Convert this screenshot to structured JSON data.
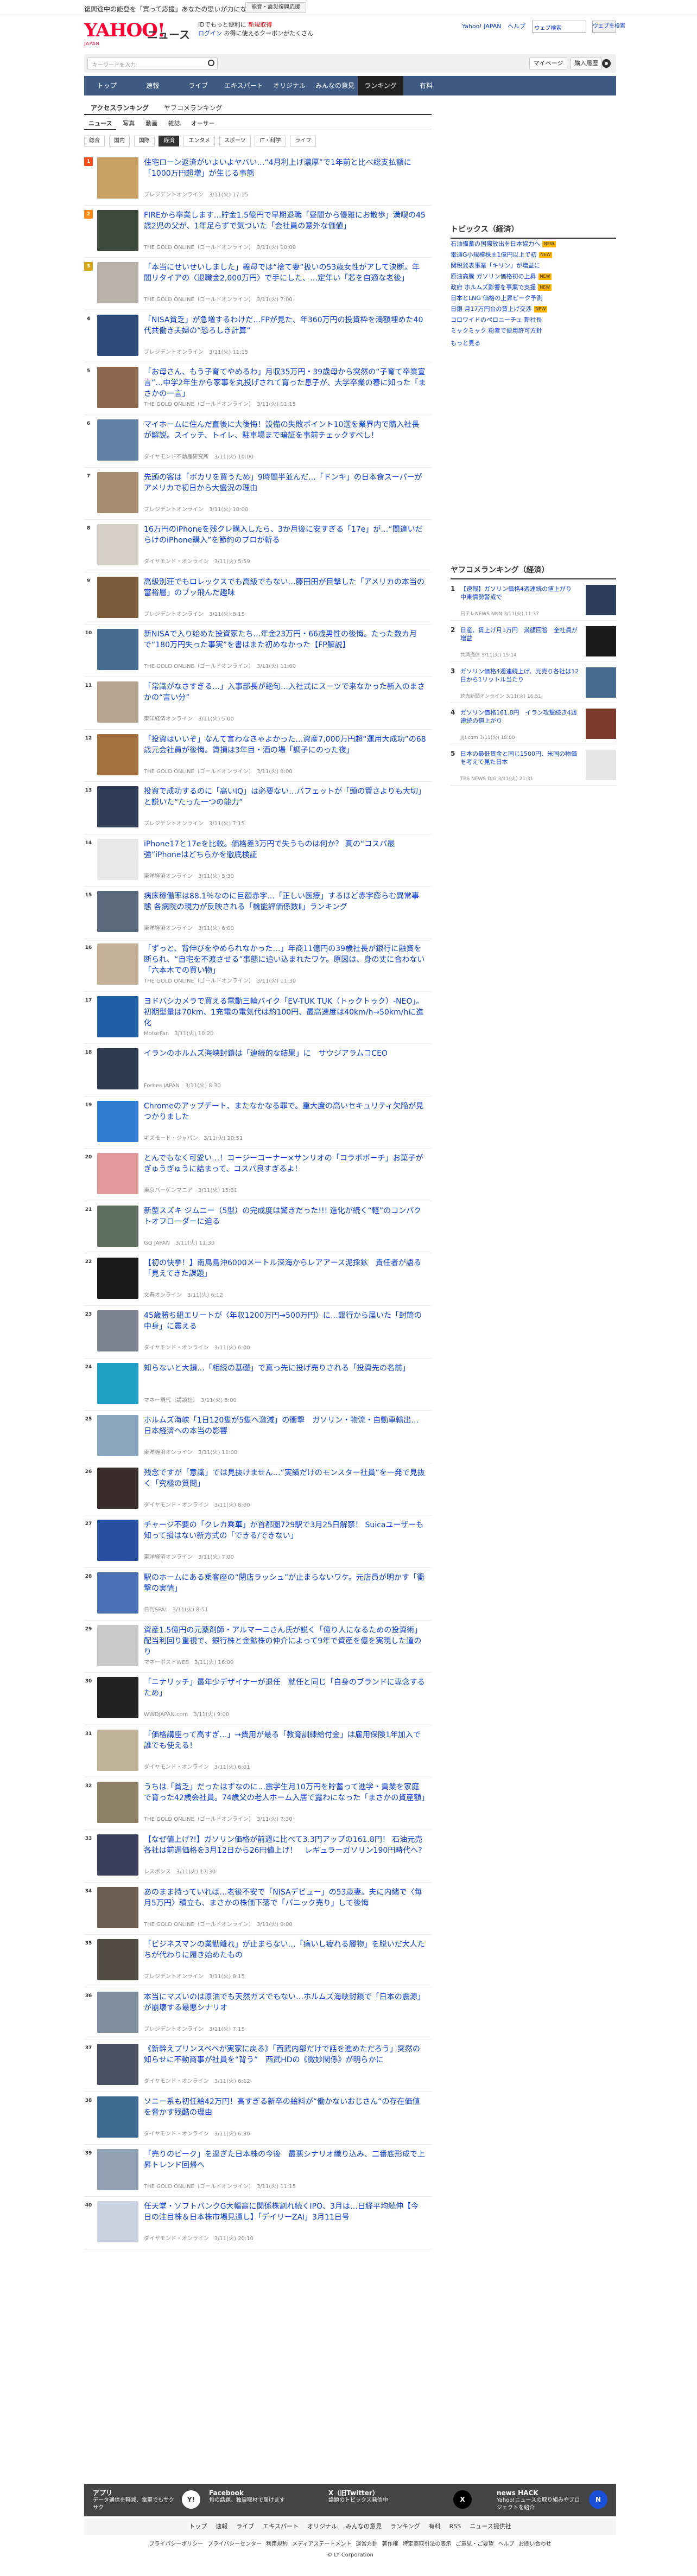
{
  "notice": {
    "text": "復興途中の能登を「買って応援」あなたの思いが力になります。",
    "badge": "能登・震災復興応援"
  },
  "header": {
    "logo": "YAHOO!",
    "logo_sub": "JAPAN",
    "service": "ニュース",
    "links_row1_prefix": "IDでもっと便利に",
    "links_row1_link": "新規取得",
    "links_row2_prefix": "ログイン",
    "links_row2_text": "お得に使えるクーポンがたくさん",
    "right_links": [
      "Yahoo! JAPAN",
      "ヘルプ"
    ],
    "search_placeholder": "ウェブ検索",
    "search_button": "ウェブを検索"
  },
  "searchbar": {
    "placeholder": "キーワードを入力",
    "mypage": "マイページ",
    "purchase": "購入履歴"
  },
  "nav": [
    "トップ",
    "速報",
    "ライブ",
    "エキスパート",
    "オリジナル",
    "みんなの意見",
    "ランキング",
    "有料"
  ],
  "subtabs": [
    "アクセスランキング",
    "ヤフコメランキング"
  ],
  "section_tabs": [
    "ニュース",
    "写真",
    "動画",
    "雑誌",
    "オーサー"
  ],
  "category_tabs": [
    "総合",
    "国内",
    "国際",
    "経済",
    "エンタメ",
    "スポーツ",
    "IT・科学",
    "ライフ"
  ],
  "ranking": [
    {
      "rank": "1",
      "title": "住宅ローン返済がいよいよヤバい…“4月利上げ濃厚”で1年前と比べ総支払額に「1000万円超増」が生じる事態",
      "meta": "プレジデントオンライン　3/11(火) 17:15"
    },
    {
      "rank": "2",
      "title": "FIREから卒業します…貯金1.5億円で早期退職「昼間から優雅にお散歩」満喫の45歳2児の父が、1年足らずで気づいた「会社員の意外な価値」",
      "meta": "THE GOLD ONLINE（ゴールドオンライン）　3/11(火) 10:00"
    },
    {
      "rank": "3",
      "title": "「本当にせいせいしました」義母では“捨て妻”扱いの53歳女性がアして決断。年間リタイアの〈退職金2,000万円〉で手にした、…定年い「芯を自適な老後」",
      "meta": "THE GOLD ONLINE（ゴールドオンライン）　3/11(火) 7:00"
    },
    {
      "rank": "4",
      "title": "「NISA貧乏」が急増するわけだ…FPが見た、年360万円の投資枠を満額埋めた40代共働き夫婦の“恐ろしき計算”",
      "meta": "プレジデントオンライン　3/11(火) 11:15"
    },
    {
      "rank": "5",
      "title": "「お母さん、もう子育てやめるわ」月収35万円・39歳母から突然の“子育て卒業宣言”…中学2年生から家事を丸投げされて育った息子が、大学卒業の春に知った「まさかの一言」",
      "meta": "THE GOLD ONLINE（ゴールドオンライン）　3/11(火) 11:15"
    },
    {
      "rank": "6",
      "title": "マイホームに住んだ直後に大後悔！設備の失敗ポイント10選を業界内で購入社長が解説。スイッチ、トイレ、駐車場まで暗証を事前チェックすべし！",
      "meta": "ダイヤモンド不動産研究所　3/11(火) 10:00"
    },
    {
      "rank": "7",
      "title": "先頭の客は「ボカリを買うため」9時間半並んだ…「ドンキ」の日本食スーパーがアメリカで初日から大盛況の理由",
      "meta": "プレジデントオンライン　3/11(火) 10:00"
    },
    {
      "rank": "8",
      "title": "16万円のiPhoneを残クレ購入したら、3か月後に安すぎる「17e」が…“間違いだらけのiPhone購入”を節約のプロが斬る",
      "meta": "ダイヤモンド・オンライン　3/11(火) 5:59"
    },
    {
      "rank": "9",
      "title": "高級別荘でもロレックスでも高級でもない…藤田田が目撃した「アメリカの本当の富裕層」のブッ飛んだ趣味",
      "meta": "プレジデントオンライン　3/11(火) 8:15"
    },
    {
      "rank": "10",
      "title": "新NISAで入り始めた投資家たち…年金23万円・66歳男性の後悔。たった数カ月で“180万円失った事実”を書はまた初めなかった【FP解説】",
      "meta": "THE GOLD ONLINE（ゴールドオンライン）　3/11(火) 11:00"
    },
    {
      "rank": "11",
      "title": "「常識がなさすぎる…」入事部長が絶句…入社式にスーツで来なかった新入のまさかの“言い分”",
      "meta": "東洋経済オンライン　3/11(火) 5:00"
    },
    {
      "rank": "12",
      "title": "「投資はいいぞ」なんて言わなきゃよかった…資産7,000万円超“運用大成功”の68歳元会社員が後悔。賃損は3年目・酒の場「調子にのった夜」",
      "meta": "THE GOLD ONLINE（ゴールドオンライン）　3/11(火) 8:00"
    },
    {
      "rank": "13",
      "title": "投資で成功するのに「高いIQ」は必要ない…バフェットが「頭の賢さよりも大切」と説いた“たった一つの能力”",
      "meta": "プレジデントオンライン　3/11(火) 7:15"
    },
    {
      "rank": "14",
      "title": "iPhone17と17eを比較。価格差3万円で失うものは何か？ 真の“コスパ最強”iPhoneはどちらかを徹底検証",
      "meta": "東洋経済オンライン　3/11(火) 5:30"
    },
    {
      "rank": "15",
      "title": "病床稼働率は88.1％なのに巨額赤字…「正しい医療」するほど赤字膨らむ異常事態 各病院の現力が反映される「機能評価係数Ⅱ」ランキング",
      "meta": "東洋経済オンライン　3/11(火) 6:00"
    },
    {
      "rank": "16",
      "title": "「ずっと、背伸びをやめられなかった…」年商11億円の39歳社長が銀行に融資を断られ、“自宅を不渡させる”事態に追い込まれたワケ。原因は、身の丈に合わない「六本木での買い物」",
      "meta": "THE GOLD ONLINE（ゴールドオンライン）　3/11(火) 11:30"
    },
    {
      "rank": "17",
      "title": "ヨドバシカメラで買える電動三輪バイク「EV-TUK TUK（トゥクトゥク）-NEO」。初期型量は70km、1充電の電気代は約100円、最高速度は40km/h→50km/hに進化",
      "meta": "MotorFan　3/11(火) 10:20"
    },
    {
      "rank": "18",
      "title": "イランのホルムズ海峡封鎖は「連続的な結果」に　サウジアラムコCEO",
      "meta": "Forbes JAPAN　3/11(火) 8:30"
    },
    {
      "rank": "19",
      "title": "Chromeのアップデート、またなかなる罪で。重大度の高いセキュリティ欠陥が見つかりました",
      "meta": "ギズモード・ジャパン　3/11(火) 20:51"
    },
    {
      "rank": "20",
      "title": "とんでもなく可愛い…！コージーコーナー×サンリオの「コラボボーチ」お菓子がぎゅうぎゅうに詰まって、コスパ良すぎるよ！",
      "meta": "東京バーゲンマニア　3/11(火) 15:31"
    },
    {
      "rank": "21",
      "title": "新型スズキ ジムニー（5型）の完成度は驚きだった!!! 進化が続く“軽”のコンパクトオフローダーに迫る",
      "meta": "GQ JAPAN　3/11(火) 11:30"
    },
    {
      "rank": "22",
      "title": "【初の快挙！】南鳥島沖6000メートル深海からレアアース泥採鉱　責任者が語る「見えてきた課題」",
      "meta": "文春オンライン　3/11(火) 6:12"
    },
    {
      "rank": "23",
      "title": "45歳勝ち組エリートが〈年収1200万円→500万円〉に…銀行から届いた「封筒の中身」に震える",
      "meta": "ダイヤモンド・オンライン　3/11(火) 6:00"
    },
    {
      "rank": "24",
      "title": "知らないと大損…「相続の基礎」で真っ先に投げ売りされる「投資先の名前」",
      "meta": "マネー現代（講談社）　3/11(火) 5:00"
    },
    {
      "rank": "25",
      "title": "ホルムズ海峡「1日120隻が5隻へ激減」の衝撃　ガソリン・物流・自動車輸出…日本経済への本当の影響",
      "meta": "東洋経済オンライン　3/11(火) 11:00"
    },
    {
      "rank": "26",
      "title": "残念ですが「意識」では見抜けません…“実績だけのモンスター社員”を一発で見抜く「究極の質問」",
      "meta": "ダイヤモンド・オンライン　3/11(火) 8:00"
    },
    {
      "rank": "27",
      "title": "チャージ不要の「クレカ乗車」が首都圏729駅で3月25日解禁！ Suicaユーザーも知って損はない新方式の「できる/できない」",
      "meta": "東洋経済オンライン　3/11(火) 7:00"
    },
    {
      "rank": "28",
      "title": "駅のホームにある乗客座の“閉店ラッシュ”が止まらないワケ。元店員が明かす「衝撃の実情」",
      "meta": "日刊SPA!　3/11(火) 8:51"
    },
    {
      "rank": "29",
      "title": "資産1.5億円の元薬剤師・アルマーニさん氏が説く「億り人になるための投資術」 配当利回り重視で、銀行株と金鉱株の仲介によって9年で資産を億を実現した道のり",
      "meta": "マネーポストWEB　3/11(火) 16:00"
    },
    {
      "rank": "30",
      "title": "「ニナリッチ」最年少デザイナーが退任　就任と同じ「自身のブランドに専念するため」",
      "meta": "WWDJAPAN.com　3/11(火) 9:00"
    },
    {
      "rank": "31",
      "title": "「価格講座って高すぎ…」→費用が最る「教育訓練給付金」は雇用保険1年加入で誰でも使える！",
      "meta": "ダイヤモンド・オンライン　3/11(火) 6:01"
    },
    {
      "rank": "32",
      "title": "うちは「貧乏」だったはずなのに…震学生月10万円を貯蓄って進学・貢業を家庭で育った42歳会社員。74歳父の老人ホーム入居で露わになった「まさかの資産額」",
      "meta": "THE GOLD ONLINE（ゴールドオンライン）　3/11(火) 7:30"
    },
    {
      "rank": "33",
      "title": "【なぜ値上げ?!】ガソリン価格が前週に比べて3.3円アップの161.8円！ 石油元売各社は前週価格を3月12日から26円値上げ！　レギュラーガソリン190円時代へ?",
      "meta": "レスポンス　3/11(火) 17:30"
    },
    {
      "rank": "34",
      "title": "あのまま持っていれば…老後不安で「NISAデビュー」の53歳妻。夫に内緒で〈毎月5万円〉積立も、まさかの株価下落で「パニック売り」して後悔",
      "meta": "THE GOLD ONLINE（ゴールドオンライン）　3/11(火) 9:00"
    },
    {
      "rank": "35",
      "title": "「ビジネスマンの業勤離れ」が止まらない…「痛いし疲れる履物」を脱いだ大人たちが代わりに履き始めたもの",
      "meta": "プレジデントオンライン　3/11(火) 8:15"
    },
    {
      "rank": "36",
      "title": "本当にマズいのは原油でも天然ガスでもない…ホルムズ海峡封鎖で「日本の震源」が崩壊する最悪シナリオ",
      "meta": "プレジデントオンライン　3/11(火) 7:15"
    },
    {
      "rank": "37",
      "title": "《新幹えプリンスベベが実家に戻る》「西武内部だけで話を進めただろう」突然の知らせに不動商事が社員を“背う”　西武HDの《微妙関係》が明らかに",
      "meta": "ダイヤモンド・オンライン　3/11(火) 6:12"
    },
    {
      "rank": "38",
      "title": "ソニー系も初任給42万円！高すぎる新卒の給料が“働かないおじさん”の存在価値を脅かす残酷の理由",
      "meta": "ダイヤモンド・オンライン　3/11(火) 6:30"
    },
    {
      "rank": "39",
      "title": "「売りのピーク」を過ぎた日本株の今後　最悪シナリオ織り込み、二番底形成で上昇トレンド回帰へ",
      "meta": "THE GOLD ONLINE（ゴールドオンライン）　3/11(火) 11:15"
    },
    {
      "rank": "40",
      "title": "任天堂・ソフトバンクG大幅高に関係株割れ続くIPO、3月は…日経平均続伸【今日の注目株＆日本株市場見通し】「デイリーZAi」3月11日号",
      "meta": "ダイヤモンド・オンライン　3/11(火) 20:10"
    }
  ],
  "topics": {
    "title": "トピックス（経済）",
    "items": [
      {
        "text": "石油備蓄の国際放出を日本協力へ",
        "new": "NEW"
      },
      {
        "text": "電通G小規模株主1億円以上で初",
        "new": "NEW"
      },
      {
        "text": "関税発表事業「キリン」が増益に",
        "new": ""
      },
      {
        "text": "原油高騰 ガソリン価格初の上昇",
        "new": "NEW"
      },
      {
        "text": "政府 ホルムズ影響を事業で支援",
        "new": "NEW"
      },
      {
        "text": "日本とLNG 価格の上昇ピーク予測",
        "new": ""
      },
      {
        "text": "日銀 月17万円台の賃上げ交渉",
        "new": "NEW"
      },
      {
        "text": "コロワイドのペロニーチェ 新社長",
        "new": ""
      },
      {
        "text": "ミャクミャク 粉者で便用許可方針",
        "new": ""
      }
    ],
    "more": "もっと見る"
  },
  "comment_ranking": {
    "title": "ヤフコメランキング（経済）",
    "items": [
      {
        "rank": "1",
        "title": "【速報】ガソリン価格4週連続の値上がり　中東情勢警戒で",
        "meta": "日テレNEWS NNN 3/11(火) 11:37"
      },
      {
        "rank": "2",
        "title": "日産、賃上げ月1万円　満額回答　全社員が増益",
        "meta": "共同通信 3/11(火) 15:14"
      },
      {
        "rank": "3",
        "title": "ガソリン価格4週連続上げ、元売り各社は12日から1リットル当たり",
        "meta": "読売新聞オンライン 3/11(火) 16:51"
      },
      {
        "rank": "4",
        "title": "ガソリン価格161.8円　イラン攻撃続き4週連続の値上がり",
        "meta": "JIJI.com 3/11(火) 18:00"
      },
      {
        "rank": "5",
        "title": "日本の最低賃金と同じ1500円、米国の物価を考えて見た日本",
        "meta": "TBS NEWS DIG 3/11(火) 21:31"
      }
    ]
  },
  "footer": {
    "app_title": "アプリ",
    "app_text": "データ通信を軽減、電車でもサクサク",
    "facebook_title": "Facebook",
    "facebook_text": "旬の話題、独自取材で届けます",
    "x_title": "X（旧Twitter）",
    "x_text": "話題のトピックス発信中",
    "hack_title": "news HACK",
    "hack_text": "Yahoo!ニュースの取り組みやプロジェクトを紹介",
    "nav": [
      "トップ",
      "速報",
      "ライブ",
      "エキスパート",
      "オリジナル",
      "みんなの意見",
      "ランキング",
      "有料",
      "RSS",
      "ニュース提供社"
    ],
    "links": [
      "プライバシーポリシー",
      "プライバシーセンター",
      "利用規約",
      "メディアステートメント",
      "運営方針",
      "著作権",
      "特定商取引法の表示",
      "ご意見・ご要望",
      "ヘルプ",
      "お問い合わせ"
    ],
    "copyright": "© LY Corporation"
  },
  "colors": {
    "nav_bg": "#3e5a82",
    "link": "#0b3ec7",
    "rank_gold": "#ff4a1a"
  }
}
